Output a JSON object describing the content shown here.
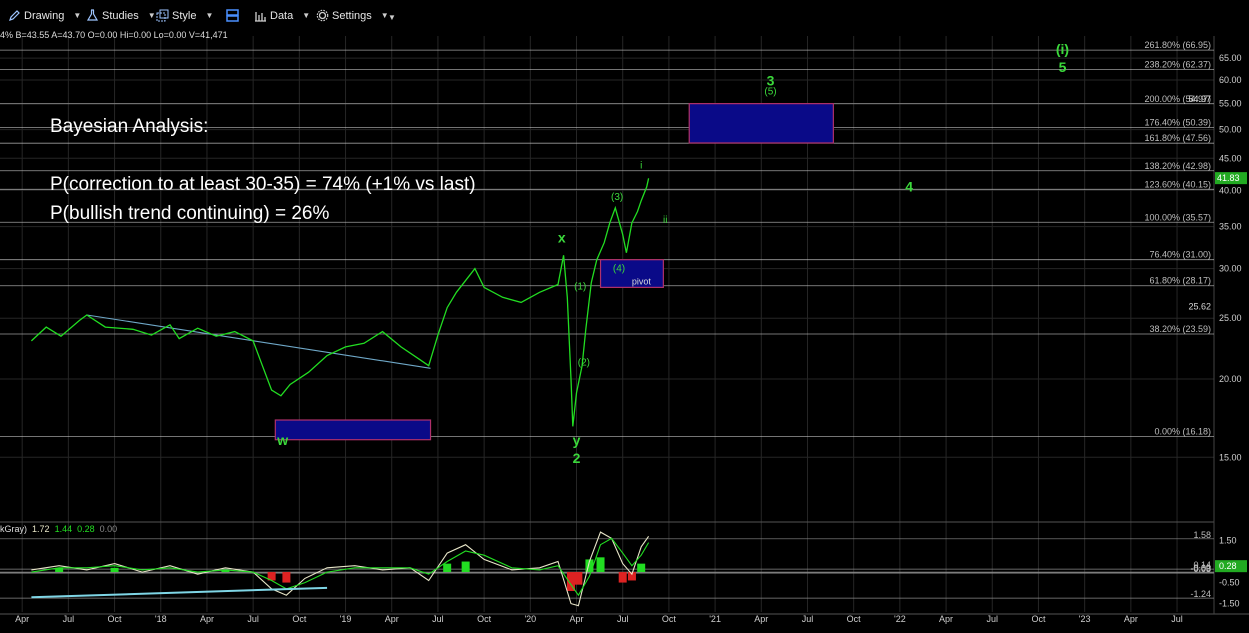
{
  "toolbar": {
    "drawing": "Drawing",
    "studies": "Studies",
    "style": "Style",
    "data": "Data",
    "settings": "Settings"
  },
  "quote": {
    "text": "4% B=43.55 A=43.70 O=0.00 Hi=0.00 Lo=0.00 V=41,471"
  },
  "analysis": {
    "heading": "Bayesian Analysis:",
    "line1": "P(correction to at least 30-35) = 74% (+1% vs last)",
    "line2": "P(bullish trend continuing) = 26%"
  },
  "indicator": {
    "name": "kGray)",
    "v1": "1.72",
    "v2": "1.44",
    "v3": "0.28",
    "v4": "0.00"
  },
  "colors": {
    "price": "#22dd22",
    "wave_label": "#3bd83b",
    "fib_line": "#cfcfcf",
    "fib_text": "#bfbfbf",
    "box_fill": "#0a0a88",
    "box_border": "#b0306a",
    "trendline": "#6fa8c8",
    "osc_line1": "#e8e6c8",
    "osc_line2": "#22dd22",
    "hist_pos": "#22dd22",
    "hist_neg": "#dd2222"
  },
  "chart_data": {
    "type": "line",
    "y_axis": {
      "ylim": [
        12,
        70
      ],
      "scale": "log",
      "ticks": [
        "65.00",
        "60.00",
        "55.00",
        "50.00",
        "45.00",
        "40.00",
        "35.00",
        "30.00",
        "25.00",
        "20.00",
        "15.00"
      ]
    },
    "x_axis": {
      "ticks": [
        "Apr",
        "Jul",
        "Oct",
        "'18",
        "Apr",
        "Jul",
        "Oct",
        "'19",
        "Apr",
        "Jul",
        "Oct",
        "'20",
        "Apr",
        "Jul",
        "Oct",
        "'21",
        "Apr",
        "Jul",
        "Oct",
        "'22",
        "Apr",
        "Jul",
        "Oct",
        "'23",
        "Apr",
        "Jul"
      ]
    },
    "series": [
      {
        "values": [
          [
            2017.3,
            23.0
          ],
          [
            2017.38,
            24.2
          ],
          [
            2017.46,
            23.4
          ],
          [
            2017.56,
            24.8
          ],
          [
            2017.6,
            25.3
          ],
          [
            2017.7,
            24.2
          ],
          [
            2017.85,
            24.0
          ],
          [
            2017.95,
            23.5
          ],
          [
            2018.05,
            24.4
          ],
          [
            2018.1,
            23.2
          ],
          [
            2018.2,
            24.1
          ],
          [
            2018.3,
            23.4
          ],
          [
            2018.4,
            23.8
          ],
          [
            2018.5,
            23.0
          ],
          [
            2018.55,
            21.0
          ],
          [
            2018.6,
            19.2
          ],
          [
            2018.65,
            18.8
          ],
          [
            2018.7,
            19.6
          ],
          [
            2018.8,
            20.5
          ],
          [
            2018.9,
            21.8
          ],
          [
            2019.0,
            22.5
          ],
          [
            2019.1,
            22.8
          ],
          [
            2019.2,
            23.8
          ],
          [
            2019.3,
            22.5
          ],
          [
            2019.4,
            21.5
          ],
          [
            2019.45,
            21.0
          ],
          [
            2019.5,
            23.5
          ],
          [
            2019.55,
            26.0
          ],
          [
            2019.6,
            27.5
          ],
          [
            2019.7,
            30.0
          ],
          [
            2019.75,
            28.0
          ],
          [
            2019.85,
            27.0
          ],
          [
            2019.95,
            26.5
          ],
          [
            2020.05,
            27.5
          ],
          [
            2020.15,
            28.3
          ],
          [
            2020.18,
            31.5
          ],
          [
            2020.2,
            27.0
          ],
          [
            2020.22,
            20.0
          ],
          [
            2020.23,
            16.8
          ],
          [
            2020.25,
            19.0
          ],
          [
            2020.28,
            21.0
          ],
          [
            2020.3,
            24.0
          ],
          [
            2020.33,
            28.5
          ],
          [
            2020.36,
            31.0
          ],
          [
            2020.4,
            33.0
          ],
          [
            2020.43,
            35.5
          ],
          [
            2020.46,
            37.5
          ],
          [
            2020.5,
            34.0
          ],
          [
            2020.52,
            31.8
          ],
          [
            2020.55,
            35.5
          ],
          [
            2020.58,
            37.0
          ],
          [
            2020.6,
            38.5
          ],
          [
            2020.63,
            40.5
          ],
          [
            2020.64,
            41.8
          ]
        ]
      }
    ],
    "fib_levels": [
      {
        "label": "261.80% (66.95)",
        "value": 66.95
      },
      {
        "label": "238.20% (62.37)",
        "value": 62.37
      },
      {
        "label": "200.00% (54.97)",
        "value": 54.97
      },
      {
        "label": "176.40% (50.39)",
        "value": 50.39
      },
      {
        "label": "161.80% (47.56)",
        "value": 47.56
      },
      {
        "label": "138.20% (42.98)",
        "value": 42.98
      },
      {
        "label": "123.60% (40.15)",
        "value": 40.15
      },
      {
        "label": "100.00% (35.57)",
        "value": 35.57
      },
      {
        "label": "76.40% (31.00)",
        "value": 31.0
      },
      {
        "label": "61.80% (28.17)",
        "value": 28.17
      },
      {
        "label": "38.20% (23.59)",
        "value": 23.59
      },
      {
        "label": "0.00% (16.18)",
        "value": 16.18
      }
    ],
    "price_tags": [
      {
        "text": "54.97",
        "value": 54.97,
        "style": "overlay"
      },
      {
        "text": "41.83",
        "value": 41.83,
        "style": "last"
      },
      {
        "text": "25.62",
        "value": 25.62,
        "style": "plain"
      }
    ],
    "boxes": [
      {
        "x0": 2018.62,
        "x1": 2019.46,
        "y0": 16.0,
        "y1": 17.2,
        "label": ""
      },
      {
        "x0": 2020.38,
        "x1": 2020.72,
        "y0": 28.0,
        "y1": 31.0,
        "label": "pivot"
      },
      {
        "x0": 2020.86,
        "x1": 2021.64,
        "y0": 47.6,
        "y1": 55.0,
        "label": ""
      }
    ],
    "trendline": {
      "x0": 2017.6,
      "y0": 25.3,
      "x1": 2019.46,
      "y1": 20.8
    },
    "wave_labels": [
      {
        "text": "(i)",
        "x": 2022.88,
        "y": 66.0,
        "size": "large"
      },
      {
        "text": "5",
        "x": 2022.88,
        "y": 61.8,
        "size": "large"
      },
      {
        "text": "3",
        "x": 2021.3,
        "y": 58.8,
        "size": "large"
      },
      {
        "text": "(5)",
        "x": 2021.3,
        "y": 56.9,
        "size": "small"
      },
      {
        "text": "4",
        "x": 2022.05,
        "y": 39.8,
        "size": "large"
      },
      {
        "text": "x",
        "x": 2020.17,
        "y": 33.0,
        "size": "large"
      },
      {
        "text": "y",
        "x": 2020.25,
        "y": 15.7,
        "size": "large"
      },
      {
        "text": "2",
        "x": 2020.25,
        "y": 14.7,
        "size": "large"
      },
      {
        "text": "w",
        "x": 2018.66,
        "y": 15.7,
        "size": "large"
      },
      {
        "text": "(3)",
        "x": 2020.47,
        "y": 38.6,
        "size": "small"
      },
      {
        "text": "(4)",
        "x": 2020.48,
        "y": 29.7,
        "size": "small"
      },
      {
        "text": "(1)",
        "x": 2020.27,
        "y": 27.8,
        "size": "small"
      },
      {
        "text": "(2)",
        "x": 2020.29,
        "y": 21.0,
        "size": "small"
      },
      {
        "text": "i",
        "x": 2020.6,
        "y": 43.3,
        "size": "small"
      },
      {
        "text": "ii",
        "x": 2020.73,
        "y": 35.5,
        "size": "small"
      }
    ],
    "oscillator": {
      "ylim": [
        -1.9,
        2.0
      ],
      "ticks": [
        "1.50",
        "-0.50",
        "-1.50"
      ],
      "levels": [
        {
          "text": "1.58",
          "value": 1.58
        },
        {
          "text": "0.14",
          "value": 0.14
        },
        {
          "text": "0.00",
          "value": 0.0
        },
        {
          "text": "-0.03",
          "value": -0.03
        },
        {
          "text": "-0.05",
          "value": -0.05
        },
        {
          "text": "-1.24",
          "value": -1.24
        }
      ],
      "last_tag": "0.28",
      "line1": [
        [
          2017.3,
          0.1
        ],
        [
          2017.45,
          0.3
        ],
        [
          2017.6,
          0.1
        ],
        [
          2017.75,
          0.4
        ],
        [
          2017.9,
          0.0
        ],
        [
          2018.05,
          0.3
        ],
        [
          2018.2,
          -0.1
        ],
        [
          2018.35,
          0.2
        ],
        [
          2018.5,
          0.0
        ],
        [
          2018.6,
          -0.8
        ],
        [
          2018.68,
          -1.1
        ],
        [
          2018.78,
          -0.3
        ],
        [
          2018.9,
          0.2
        ],
        [
          2019.05,
          0.3
        ],
        [
          2019.2,
          0.1
        ],
        [
          2019.35,
          0.2
        ],
        [
          2019.45,
          -0.4
        ],
        [
          2019.55,
          0.9
        ],
        [
          2019.65,
          1.3
        ],
        [
          2019.75,
          0.6
        ],
        [
          2019.9,
          0.1
        ],
        [
          2020.05,
          0.2
        ],
        [
          2020.15,
          0.5
        ],
        [
          2020.22,
          -1.5
        ],
        [
          2020.26,
          -1.6
        ],
        [
          2020.32,
          0.5
        ],
        [
          2020.38,
          1.9
        ],
        [
          2020.44,
          1.6
        ],
        [
          2020.5,
          0.4
        ],
        [
          2020.55,
          -0.1
        ],
        [
          2020.6,
          1.2
        ],
        [
          2020.64,
          1.7
        ]
      ],
      "line2": [
        [
          2017.3,
          0.0
        ],
        [
          2017.45,
          0.2
        ],
        [
          2017.6,
          0.2
        ],
        [
          2017.75,
          0.3
        ],
        [
          2017.9,
          0.1
        ],
        [
          2018.05,
          0.2
        ],
        [
          2018.2,
          0.0
        ],
        [
          2018.35,
          0.1
        ],
        [
          2018.5,
          0.0
        ],
        [
          2018.6,
          -0.4
        ],
        [
          2018.68,
          -0.8
        ],
        [
          2018.78,
          -0.5
        ],
        [
          2018.9,
          0.0
        ],
        [
          2019.05,
          0.2
        ],
        [
          2019.2,
          0.2
        ],
        [
          2019.35,
          0.2
        ],
        [
          2019.45,
          -0.1
        ],
        [
          2019.55,
          0.5
        ],
        [
          2019.65,
          1.0
        ],
        [
          2019.75,
          0.8
        ],
        [
          2019.9,
          0.2
        ],
        [
          2020.05,
          0.1
        ],
        [
          2020.15,
          0.3
        ],
        [
          2020.22,
          -0.6
        ],
        [
          2020.26,
          -1.1
        ],
        [
          2020.32,
          -0.2
        ],
        [
          2020.38,
          1.3
        ],
        [
          2020.44,
          1.6
        ],
        [
          2020.5,
          0.9
        ],
        [
          2020.55,
          0.3
        ],
        [
          2020.6,
          0.8
        ],
        [
          2020.64,
          1.4
        ]
      ],
      "histogram": [
        [
          2017.45,
          0.2
        ],
        [
          2017.75,
          0.2
        ],
        [
          2018.35,
          0.1
        ],
        [
          2018.6,
          -0.4
        ],
        [
          2018.68,
          -0.5
        ],
        [
          2019.55,
          0.4
        ],
        [
          2019.65,
          0.5
        ],
        [
          2020.22,
          -0.9
        ],
        [
          2020.26,
          -0.6
        ],
        [
          2020.32,
          0.6
        ],
        [
          2020.38,
          0.7
        ],
        [
          2020.5,
          -0.5
        ],
        [
          2020.55,
          -0.4
        ],
        [
          2020.6,
          0.4
        ]
      ]
    },
    "osc_trendline": {
      "x0": 2017.3,
      "y0": -1.2,
      "x1": 2018.9,
      "y1": -0.75
    }
  }
}
